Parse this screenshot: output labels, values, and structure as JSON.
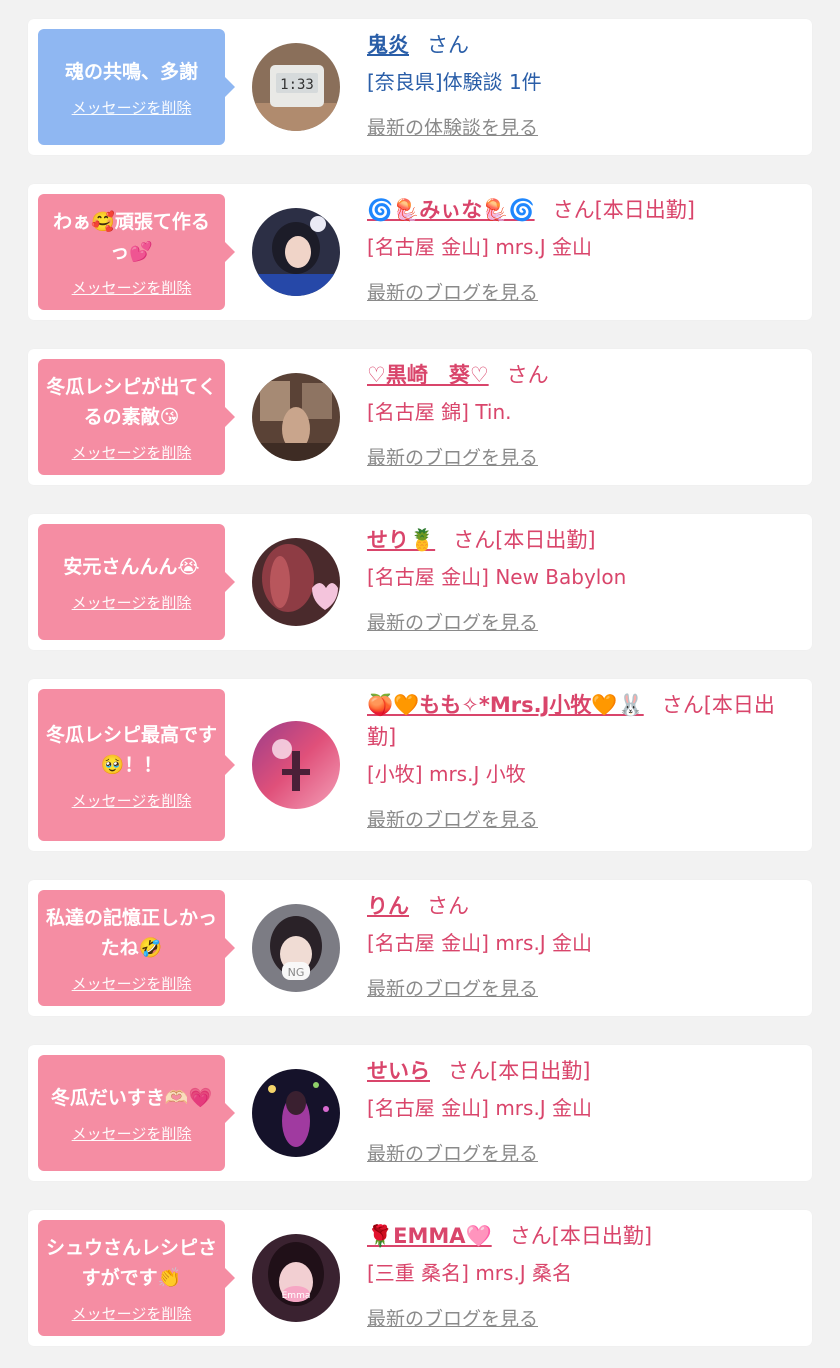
{
  "delete_label": "メッセージを削除",
  "colors": {
    "blue_bubble": "#8fb7f2",
    "pink_bubble": "#f58da3",
    "blue_text": "#2a5ea8",
    "pink_text": "#d9456b",
    "link_gray": "#8a8a8a"
  },
  "messages": [
    {
      "theme": "blue",
      "message": "魂の共鳴、多謝",
      "name": "鬼炎",
      "suffix": "さん",
      "location": "[奈良県]体験談 1件",
      "link": "最新の体験談を見る",
      "avatar_icon": "clock-photo"
    },
    {
      "theme": "pink",
      "message": "わぁ🥰頑張て作るっ💕",
      "name": "🌀🪼みぃな🪼🌀",
      "suffix": "さん[本日出勤]",
      "location": "[名古屋 金山] mrs.J 金山",
      "link": "最新のブログを見る",
      "avatar_icon": "girl-photo"
    },
    {
      "theme": "pink",
      "message": "冬瓜レシピが出てくるの素敵😘",
      "name": "♡黒崎　葵♡",
      "suffix": "さん",
      "location": "[名古屋 錦] Tin.",
      "link": "最新のブログを見る",
      "avatar_icon": "room-photo"
    },
    {
      "theme": "pink",
      "message": "安元さんんん😭",
      "name": "せり🍍",
      "suffix": "さん[本日出勤]",
      "location": "[名古屋 金山] New Babylon",
      "link": "最新のブログを見る",
      "avatar_icon": "hair-photo"
    },
    {
      "theme": "pink",
      "message": "冬瓜レシピ最高です🥹！！",
      "name": "🍑🧡もも✧*Mrs.J小牧🧡🐰",
      "suffix": "さん[本日出勤]",
      "location": "[小牧] mrs.J 小牧",
      "link": "最新のブログを見る",
      "avatar_icon": "pink-light-photo"
    },
    {
      "theme": "pink",
      "message": "私達の記憶正しかったね🤣",
      "name": "りん",
      "suffix": "さん",
      "location": "[名古屋 金山] mrs.J 金山",
      "link": "最新のブログを見る",
      "avatar_icon": "ng-face-photo"
    },
    {
      "theme": "pink",
      "message": "冬瓜だいすき🫶🏻💗",
      "name": "せいら",
      "suffix": "さん[本日出勤]",
      "location": "[名古屋 金山] mrs.J 金山",
      "link": "最新のブログを見る",
      "avatar_icon": "night-photo"
    },
    {
      "theme": "pink",
      "message": "シュウさんレシピさすがです👏",
      "name": "🌹EMMA🩷",
      "suffix": "さん[本日出勤]",
      "location": "[三重 桑名] mrs.J 桑名",
      "link": "最新のブログを見る",
      "avatar_icon": "emma-face-photo"
    }
  ]
}
